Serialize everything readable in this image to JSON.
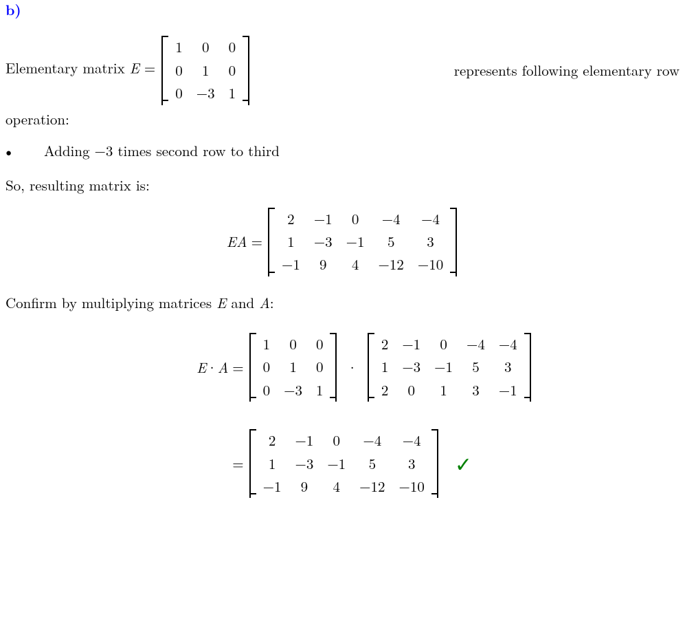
{
  "part_label": "b)",
  "intro": {
    "pre": "Elementary matrix ",
    "var_E": "E",
    "eq": " = ",
    "post": " represents following elementary row",
    "operation_line": "operation:"
  },
  "matrix_E": {
    "rows": [
      [
        "1",
        "0",
        "0"
      ],
      [
        "0",
        "1",
        "0"
      ],
      [
        "0",
        "−3",
        "1"
      ]
    ]
  },
  "bullet_text": "Adding −3 times second row to third",
  "so_text": "So, resulting matrix is:",
  "ea_label_E": "E",
  "ea_label_A": "A",
  "ea_eq": " = ",
  "matrix_EA": {
    "rows": [
      [
        "2",
        "−1",
        "0",
        "−4",
        "−4"
      ],
      [
        "1",
        "−3",
        "−1",
        "5",
        "3"
      ],
      [
        "−1",
        "9",
        "4",
        "−12",
        "−10"
      ]
    ]
  },
  "confirm_pre": "Confirm by multiplying matrices ",
  "confirm_mid": " and ",
  "confirm_post": ":",
  "var_E2": "E",
  "var_A2": "A",
  "mult": {
    "lhs_E": "E",
    "dot": " · ",
    "lhs_A": "A",
    "eq": " = "
  },
  "matrix_E2": {
    "rows": [
      [
        "1",
        "0",
        "0"
      ],
      [
        "0",
        "1",
        "0"
      ],
      [
        "0",
        "−3",
        "1"
      ]
    ]
  },
  "matrix_A": {
    "rows": [
      [
        "2",
        "−1",
        "0",
        "−4",
        "−4"
      ],
      [
        "1",
        "−3",
        "−1",
        "5",
        "3"
      ],
      [
        "2",
        "0",
        "1",
        "3",
        "−1"
      ]
    ]
  },
  "eq2": " = ",
  "matrix_result": {
    "rows": [
      [
        "2",
        "−1",
        "0",
        "−4",
        "−4"
      ],
      [
        "1",
        "−3",
        "−1",
        "5",
        "3"
      ],
      [
        "−1",
        "9",
        "4",
        "−12",
        "−10"
      ]
    ]
  },
  "checkmark": "✓"
}
